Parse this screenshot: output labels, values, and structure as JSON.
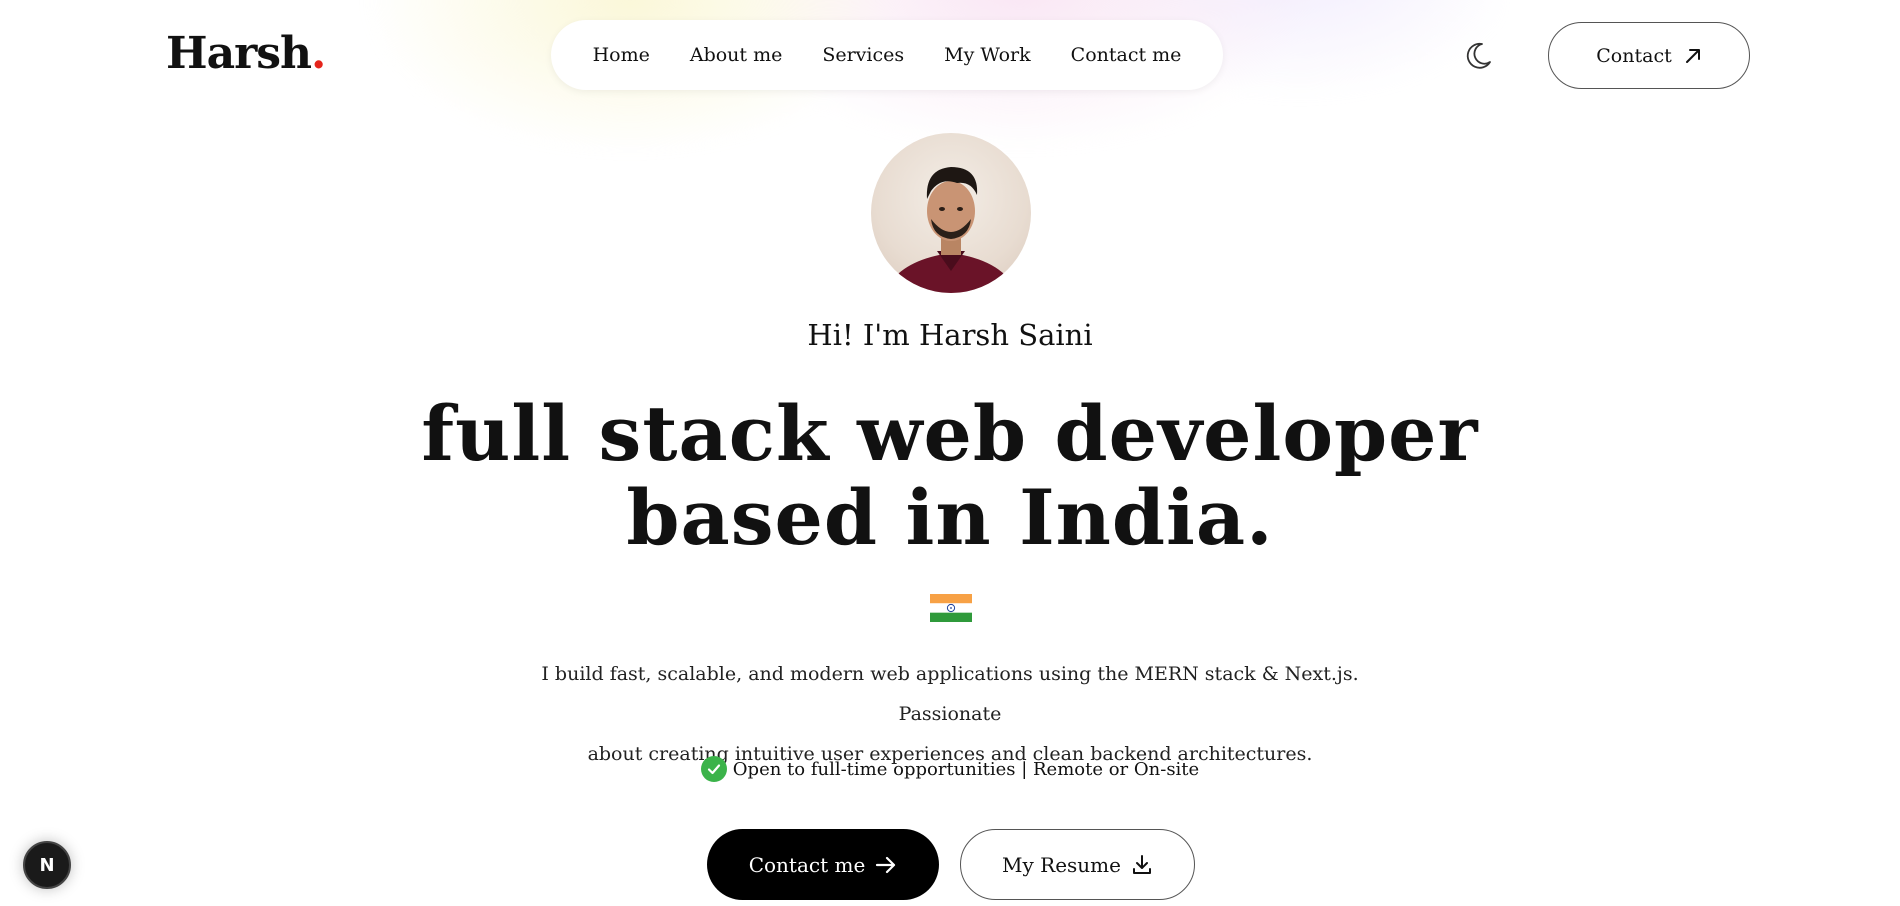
{
  "header": {
    "logo_text": "Harsh",
    "logo_dot": ".",
    "accent_dot_color": "#e5241b"
  },
  "nav": {
    "items": [
      {
        "label": "Home"
      },
      {
        "label": "About me"
      },
      {
        "label": "Services"
      },
      {
        "label": "My Work"
      },
      {
        "label": "Contact me"
      }
    ]
  },
  "theme_toggle": {
    "icon": "moon-icon"
  },
  "contact_button": {
    "label": "Contact",
    "icon": "arrow-up-right-icon"
  },
  "hero": {
    "greeting": "Hi! I'm Harsh Saini",
    "headline_line1": "full stack web developer",
    "headline_line2": "based in India.",
    "flag_icon": "india-flag-icon",
    "bio_line1": "I build fast, scalable, and modern web applications using the MERN stack & Next.js. Passionate",
    "bio_line2": "about creating intuitive user experiences and clean backend architectures.",
    "status": "Open to full-time opportunities | Remote or On-site",
    "status_color": "#3bb34a",
    "primary_button": "Contact me",
    "secondary_button": "My Resume"
  },
  "dev_badge": {
    "label": "N"
  }
}
